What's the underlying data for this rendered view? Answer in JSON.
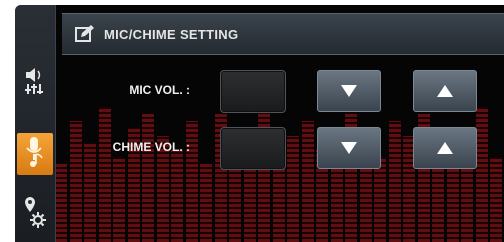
{
  "title": "MIC/CHIME SETTING",
  "colors": {
    "accent": "#e8951f",
    "panel": "#2c333a",
    "eq": "#6a0f12"
  },
  "sidebar": {
    "items": [
      {
        "name": "sound-eq-icon",
        "active": false
      },
      {
        "name": "mic-music-icon",
        "active": true
      },
      {
        "name": "location-settings-icon",
        "active": false
      }
    ]
  },
  "rows": [
    {
      "label": "MIC VOL. :",
      "down_icon": "triangle-down-icon",
      "up_icon": "triangle-up-icon"
    },
    {
      "label": "CHIME VOL. :",
      "down_icon": "triangle-down-icon",
      "up_icon": "triangle-up-icon"
    }
  ],
  "eq_levels": [
    0.55,
    0.85,
    0.7,
    0.95,
    0.6,
    0.8,
    0.9,
    0.75,
    0.65,
    0.85,
    0.55,
    0.9,
    0.8,
    0.7,
    0.95,
    0.6,
    0.75,
    0.85,
    0.65,
    0.8,
    0.9,
    0.7,
    0.6,
    0.85,
    0.75,
    0.9,
    0.65,
    0.8,
    0.7,
    0.95,
    0.6,
    0.85,
    0.75
  ]
}
